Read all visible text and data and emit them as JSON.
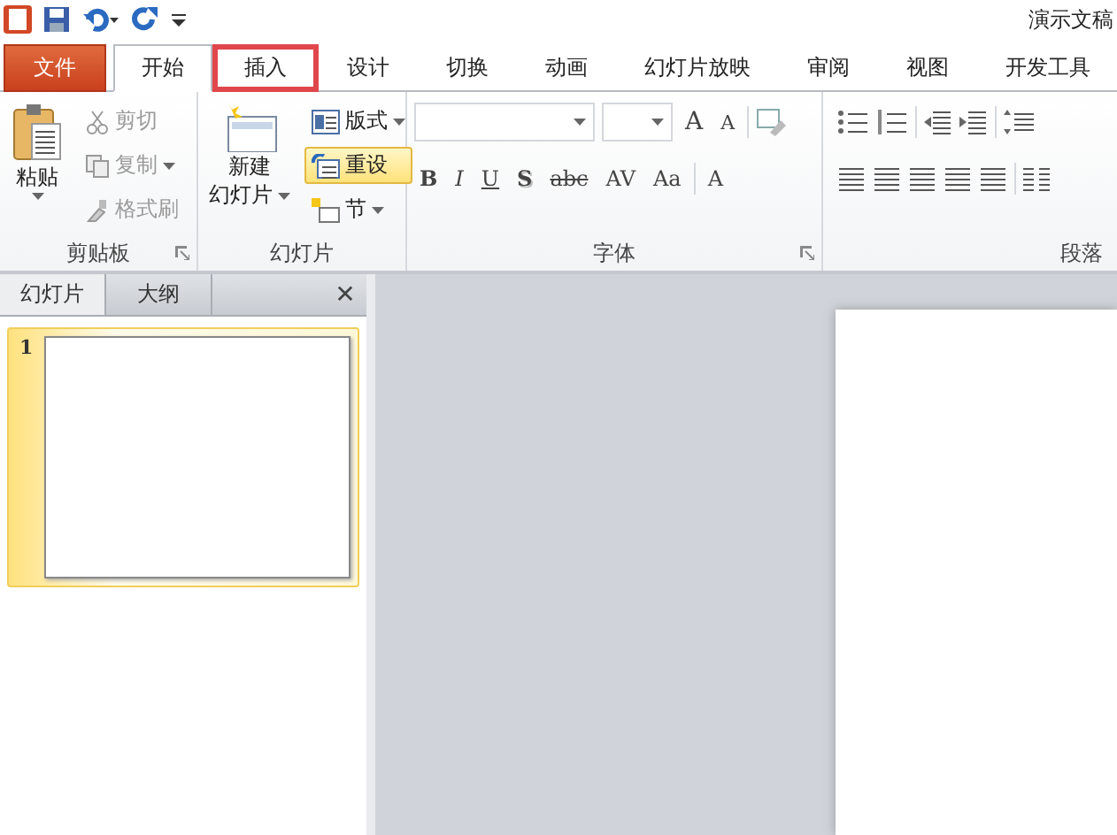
{
  "window": {
    "title": "演示文稿"
  },
  "ribbon_tabs": [
    {
      "label": "文件",
      "kind": "file",
      "selected": false,
      "highlighted": false
    },
    {
      "label": "开始",
      "kind": "tab",
      "selected": true,
      "highlighted": false
    },
    {
      "label": "插入",
      "kind": "tab",
      "selected": false,
      "highlighted": true
    },
    {
      "label": "设计",
      "kind": "tab",
      "selected": false,
      "highlighted": false
    },
    {
      "label": "切换",
      "kind": "tab",
      "selected": false,
      "highlighted": false
    },
    {
      "label": "动画",
      "kind": "tab",
      "selected": false,
      "highlighted": false
    },
    {
      "label": "幻灯片放映",
      "kind": "tab",
      "selected": false,
      "highlighted": false
    },
    {
      "label": "审阅",
      "kind": "tab",
      "selected": false,
      "highlighted": false
    },
    {
      "label": "视图",
      "kind": "tab",
      "selected": false,
      "highlighted": false
    },
    {
      "label": "开发工具",
      "kind": "tab",
      "selected": false,
      "highlighted": false
    }
  ],
  "clipboard": {
    "label": "剪贴板",
    "paste": "粘贴",
    "commands": [
      {
        "label": "剪切",
        "disabled": true,
        "dropdown": false
      },
      {
        "label": "复制",
        "disabled": true,
        "dropdown": true
      },
      {
        "label": "格式刷",
        "disabled": true,
        "dropdown": false
      }
    ]
  },
  "slides_group": {
    "label": "幻灯片",
    "new_slide": [
      "新建",
      "幻灯片"
    ],
    "commands": [
      {
        "label": "版式",
        "selected": false,
        "dropdown": true
      },
      {
        "label": "重设",
        "selected": true,
        "dropdown": false
      },
      {
        "label": "节",
        "selected": false,
        "dropdown": true
      }
    ]
  },
  "font_group": {
    "label": "字体",
    "size_buttons": [
      "A",
      "A"
    ],
    "format_buttons": [
      {
        "label": "B",
        "kind": "bold"
      },
      {
        "label": "I",
        "kind": "italic"
      },
      {
        "label": "U",
        "kind": "underline"
      },
      {
        "label": "S",
        "kind": "shadow"
      },
      {
        "label": "abc",
        "kind": "strike"
      },
      {
        "label": "AV",
        "kind": "spacing"
      },
      {
        "label": "Aa",
        "kind": "case"
      },
      {
        "label": "A",
        "kind": "color"
      }
    ]
  },
  "paragraph_group": {
    "label": "段落"
  },
  "pane_tabs": [
    {
      "label": "幻灯片",
      "selected": true
    },
    {
      "label": "大纲",
      "selected": false
    }
  ],
  "pane_close": "✕",
  "slides": [
    {
      "number": "1",
      "selected": true
    }
  ]
}
